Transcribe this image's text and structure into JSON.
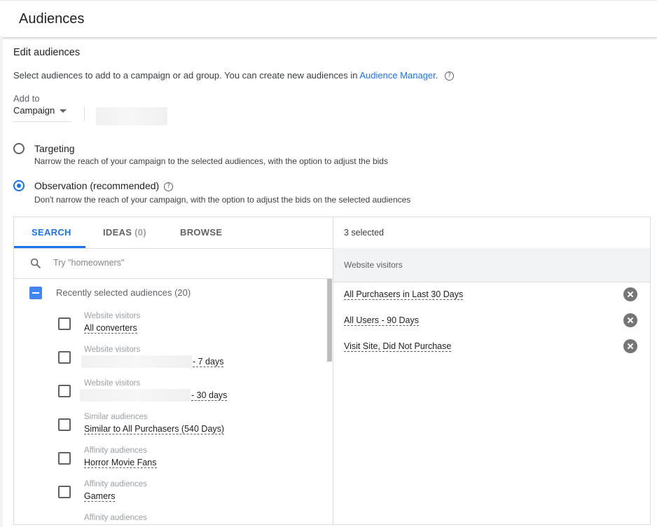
{
  "header": {
    "title": "Audiences"
  },
  "section": {
    "title": "Edit audiences",
    "description": "Select audiences to add to a campaign or ad group. You can create new audiences in ",
    "link": "Audience Manager",
    "link_suffix": ".",
    "help_icon": "help-circle-icon"
  },
  "add_to": {
    "label": "Add to",
    "value": "Campaign"
  },
  "options": [
    {
      "title": "Targeting",
      "subtitle": "Narrow the reach of your campaign to the selected audiences, with the option to adjust the bids",
      "selected": false
    },
    {
      "title": "Observation (recommended)",
      "subtitle": "Don't narrow the reach of your campaign, with the option to adjust the bids on the selected audiences",
      "selected": true
    }
  ],
  "tabs": [
    {
      "label": "SEARCH",
      "count": ""
    },
    {
      "label": "IDEAS",
      "count": "(0)"
    },
    {
      "label": "BROWSE",
      "count": ""
    }
  ],
  "search": {
    "placeholder": "Try \"homeowners\"",
    "value": ""
  },
  "group": {
    "label": "Recently selected audiences (20)"
  },
  "items": [
    {
      "category": "Website visitors",
      "name": "All converters"
    },
    {
      "category": "Website visitors",
      "name": "- 7 days"
    },
    {
      "category": "Website visitors",
      "name": "- 30 days"
    },
    {
      "category": "Similar audiences",
      "name": "Similar to All Purchasers (540 Days)"
    },
    {
      "category": "Affinity audiences",
      "name": "Horror Movie Fans"
    },
    {
      "category": "Affinity audiences",
      "name": "Gamers"
    },
    {
      "category": "Affinity audiences",
      "name": ""
    }
  ],
  "selected": {
    "count_label": "3 selected",
    "category": "Website visitors",
    "items": [
      {
        "name": "All Purchasers in Last 30 Days"
      },
      {
        "name": "All Users - 90 Days"
      },
      {
        "name": "Visit Site, Did Not Purchase"
      }
    ]
  },
  "colors": {
    "accent": "#1a73e8",
    "checkbox_indeterminate": "#4285f4",
    "remove": "#757575"
  }
}
